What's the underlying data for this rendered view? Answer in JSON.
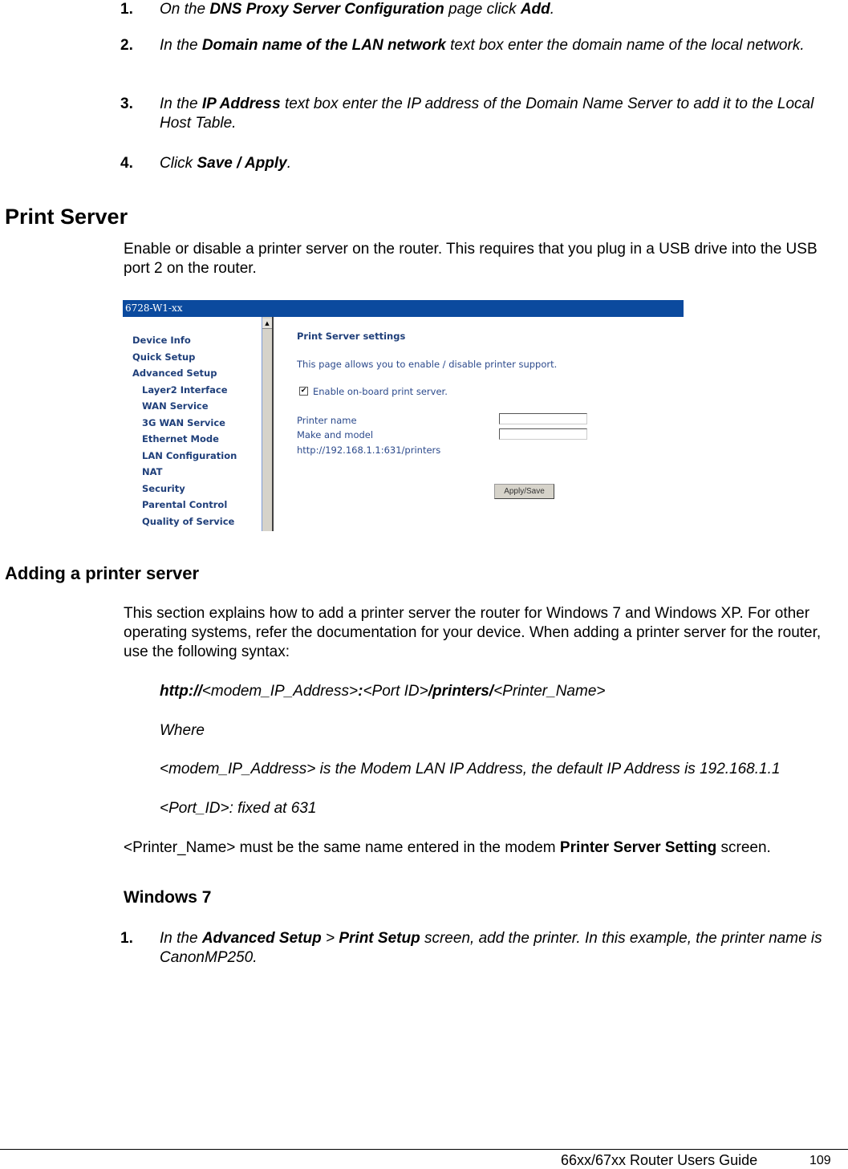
{
  "steps_top": [
    {
      "num": "1.",
      "parts": [
        [
          "i",
          "On the "
        ],
        [
          "b",
          "DNS Proxy Server Configuration"
        ],
        [
          "i",
          " page click "
        ],
        [
          "b",
          "Add"
        ],
        [
          "i",
          "."
        ]
      ]
    },
    {
      "num": "2.",
      "parts": [
        [
          "i",
          "In the "
        ],
        [
          "b",
          "Domain name of the LAN network"
        ],
        [
          "i",
          " text box enter the domain name of the local network."
        ]
      ]
    },
    {
      "num": "3.",
      "parts": [
        [
          "i",
          "In the "
        ],
        [
          "b",
          "IP Address"
        ],
        [
          "i",
          " text box enter the IP address of the Domain Name Server to add it to the Local Host Table."
        ]
      ]
    },
    {
      "num": "4.",
      "parts": [
        [
          "i",
          "Click "
        ],
        [
          "b",
          "Save / Apply"
        ],
        [
          "i",
          "."
        ]
      ]
    }
  ],
  "print_server": {
    "heading": "Print Server",
    "intro": "Enable or disable a printer server on the router. This requires that you plug in a USB drive into the USB port 2 on the router."
  },
  "router_ui": {
    "header_title": "6728-W1-xx",
    "nav_items": [
      {
        "label": "Device Info",
        "level": 0
      },
      {
        "label": "Quick Setup",
        "level": 0
      },
      {
        "label": "Advanced Setup",
        "level": 0
      },
      {
        "label": "Layer2 Interface",
        "level": 1
      },
      {
        "label": "WAN Service",
        "level": 1
      },
      {
        "label": "3G WAN Service",
        "level": 1
      },
      {
        "label": "Ethernet Mode",
        "level": 1
      },
      {
        "label": "LAN Configuration",
        "level": 1
      },
      {
        "label": "NAT",
        "level": 1
      },
      {
        "label": "Security",
        "level": 1
      },
      {
        "label": "Parental Control",
        "level": 1
      },
      {
        "label": "Quality of Service",
        "level": 1
      }
    ],
    "scroll_up_icon": "▲",
    "page_title": "Print Server settings",
    "description": "This page allows you to enable / disable printer support.",
    "enable_checkbox": {
      "label": "Enable on-board print server.",
      "checked": true,
      "glyph": "✔"
    },
    "printer_name_label": "Printer name",
    "printer_name_value": "",
    "make_model_label": "Make and model",
    "make_model_value": "",
    "url_text": "http://192.168.1.1:631/printers",
    "apply_button": "Apply/Save"
  },
  "adding": {
    "heading": "Adding a printer server",
    "para": "This section explains how to add a printer server the router for Windows 7 and Windows XP. For other operating systems, refer the documentation for your device. When adding a printer server for the router, use the following syntax:",
    "syntax_parts": [
      [
        "b",
        "http://"
      ],
      [
        "i",
        "<modem_IP_Address>"
      ],
      [
        "b",
        ":"
      ],
      [
        "i",
        "<Port ID>"
      ],
      [
        "b",
        "/printers/"
      ],
      [
        "i",
        "<Printer_Name>"
      ]
    ],
    "where": "Where",
    "ip_note": "<modem_IP_Address> is the Modem LAN IP Address, the default IP Address is 192.168.1.1",
    "port_note": "<Port_ID>: fixed at 631",
    "name_note_parts": [
      [
        "n",
        "<Printer_Name> must be the same name entered in the modem "
      ],
      [
        "b",
        "Printer Server Setting"
      ],
      [
        "n",
        " screen."
      ]
    ]
  },
  "windows7": {
    "heading": "Windows 7",
    "steps": [
      {
        "num": "1.",
        "parts": [
          [
            "i",
            "In the "
          ],
          [
            "b",
            "Advanced Setup"
          ],
          [
            "i",
            " > "
          ],
          [
            "b",
            "Print Setup"
          ],
          [
            "i",
            " screen, add the printer. In this example, the printer name is CanonMP250."
          ]
        ]
      }
    ]
  },
  "footer": {
    "title": "66xx/67xx Router Users Guide",
    "page": "109"
  },
  "colors": {
    "ui_header": "#0b4a9e",
    "ui_nav_text": "#1f3f7a",
    "ui_content_text": "#2c4a8c"
  }
}
